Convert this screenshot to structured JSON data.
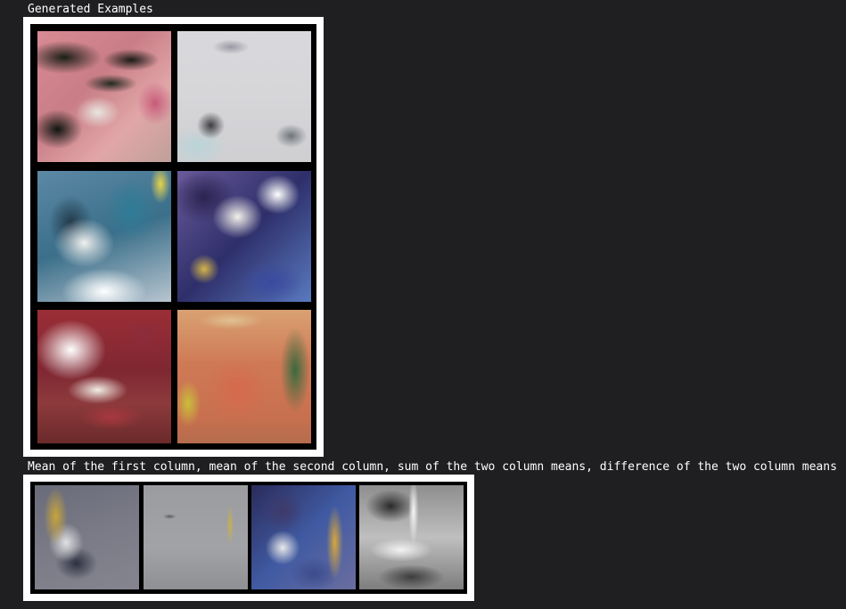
{
  "labels": {
    "generated_examples": "Generated Examples",
    "means_caption": "Mean of the first column, mean of the second column, sum of the two column means, difference of the two column means"
  },
  "generated_grid": {
    "rows": 3,
    "columns": 2,
    "tiles": [
      {
        "image": "generated-example-1"
      },
      {
        "image": "generated-example-2"
      },
      {
        "image": "generated-example-3"
      },
      {
        "image": "generated-example-4"
      },
      {
        "image": "generated-example-5"
      },
      {
        "image": "generated-example-6"
      }
    ]
  },
  "means_row": {
    "tiles": [
      {
        "image": "mean-first-column"
      },
      {
        "image": "mean-second-column"
      },
      {
        "image": "sum-of-column-means"
      },
      {
        "image": "difference-of-column-means"
      }
    ]
  },
  "colors": {
    "background": "#1f1f22",
    "text": "#ffffff",
    "frame": "#ffffff",
    "inner_border": "#000000"
  }
}
